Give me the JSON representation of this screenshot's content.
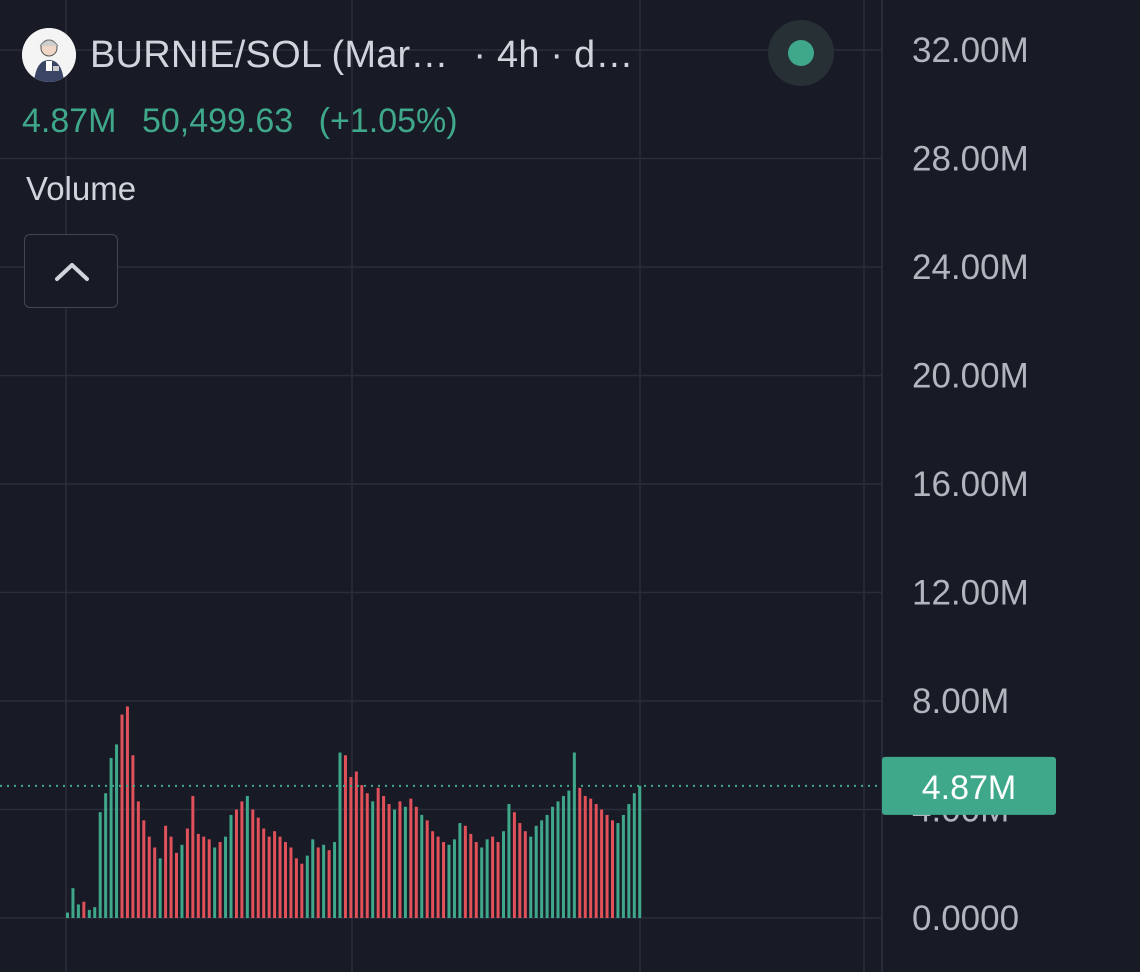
{
  "header": {
    "symbol_label": "BURNIE/SOL (Mar…",
    "interval_label": "· 4h · d…",
    "status_color": "#3fa88a"
  },
  "subline": {
    "volume_value": "4.87M",
    "price_value": "50,499.63",
    "change_value": "(+1.05%)"
  },
  "legend": {
    "title": "Volume",
    "collapse_icon": "chevron-up-icon"
  },
  "chart_data": {
    "type": "bar",
    "series": [
      {
        "name": "Volume"
      }
    ],
    "y_ticks": [
      "32.00M",
      "28.00M",
      "24.00M",
      "20.00M",
      "16.00M",
      "12.00M",
      "8.00M",
      "4.00M",
      "0.0000"
    ],
    "ylim": [
      0,
      32000000
    ],
    "grid": true,
    "last_value": 4870000,
    "last_value_label": "4.87M",
    "colors": {
      "up": "#3fa88a",
      "down": "#e0515a",
      "background": "#181a26",
      "grid": "#2a2d3a",
      "axis_text": "#b2b5be"
    },
    "bars": [
      [
        0.2,
        true
      ],
      [
        1.1,
        true
      ],
      [
        0.5,
        true
      ],
      [
        0.6,
        false
      ],
      [
        0.3,
        true
      ],
      [
        0.4,
        true
      ],
      [
        3.9,
        true
      ],
      [
        4.6,
        true
      ],
      [
        5.9,
        true
      ],
      [
        6.4,
        true
      ],
      [
        7.5,
        false
      ],
      [
        7.8,
        false
      ],
      [
        6.0,
        false
      ],
      [
        4.3,
        false
      ],
      [
        3.6,
        false
      ],
      [
        3.0,
        false
      ],
      [
        2.6,
        false
      ],
      [
        2.2,
        true
      ],
      [
        3.4,
        false
      ],
      [
        3.0,
        false
      ],
      [
        2.4,
        false
      ],
      [
        2.7,
        true
      ],
      [
        3.3,
        false
      ],
      [
        4.5,
        false
      ],
      [
        3.1,
        false
      ],
      [
        3.0,
        false
      ],
      [
        2.9,
        false
      ],
      [
        2.6,
        true
      ],
      [
        2.8,
        false
      ],
      [
        3.0,
        true
      ],
      [
        3.8,
        true
      ],
      [
        4.0,
        false
      ],
      [
        4.3,
        false
      ],
      [
        4.5,
        true
      ],
      [
        4.0,
        false
      ],
      [
        3.7,
        false
      ],
      [
        3.3,
        false
      ],
      [
        3.0,
        false
      ],
      [
        3.2,
        false
      ],
      [
        3.0,
        false
      ],
      [
        2.8,
        false
      ],
      [
        2.6,
        false
      ],
      [
        2.2,
        false
      ],
      [
        2.0,
        false
      ],
      [
        2.3,
        true
      ],
      [
        2.9,
        true
      ],
      [
        2.6,
        false
      ],
      [
        2.7,
        true
      ],
      [
        2.5,
        false
      ],
      [
        2.8,
        true
      ],
      [
        6.1,
        true
      ],
      [
        6.0,
        false
      ],
      [
        5.2,
        false
      ],
      [
        5.4,
        false
      ],
      [
        4.9,
        false
      ],
      [
        4.6,
        false
      ],
      [
        4.3,
        true
      ],
      [
        4.8,
        false
      ],
      [
        4.5,
        false
      ],
      [
        4.2,
        false
      ],
      [
        4.0,
        true
      ],
      [
        4.3,
        false
      ],
      [
        4.1,
        true
      ],
      [
        4.4,
        false
      ],
      [
        4.1,
        false
      ],
      [
        3.8,
        true
      ],
      [
        3.6,
        false
      ],
      [
        3.2,
        false
      ],
      [
        3.0,
        false
      ],
      [
        2.8,
        false
      ],
      [
        2.7,
        true
      ],
      [
        2.9,
        true
      ],
      [
        3.5,
        true
      ],
      [
        3.4,
        false
      ],
      [
        3.1,
        false
      ],
      [
        2.8,
        false
      ],
      [
        2.6,
        true
      ],
      [
        2.9,
        true
      ],
      [
        3.0,
        false
      ],
      [
        2.8,
        false
      ],
      [
        3.2,
        true
      ],
      [
        4.2,
        true
      ],
      [
        3.9,
        false
      ],
      [
        3.5,
        false
      ],
      [
        3.2,
        false
      ],
      [
        3.0,
        true
      ],
      [
        3.4,
        true
      ],
      [
        3.6,
        true
      ],
      [
        3.8,
        true
      ],
      [
        4.1,
        true
      ],
      [
        4.3,
        true
      ],
      [
        4.5,
        true
      ],
      [
        4.7,
        true
      ],
      [
        6.1,
        true
      ],
      [
        4.8,
        false
      ],
      [
        4.5,
        false
      ],
      [
        4.4,
        false
      ],
      [
        4.2,
        false
      ],
      [
        4.0,
        false
      ],
      [
        3.8,
        false
      ],
      [
        3.6,
        false
      ],
      [
        3.5,
        true
      ],
      [
        3.8,
        true
      ],
      [
        4.2,
        true
      ],
      [
        4.6,
        true
      ],
      [
        4.87,
        true
      ]
    ]
  }
}
